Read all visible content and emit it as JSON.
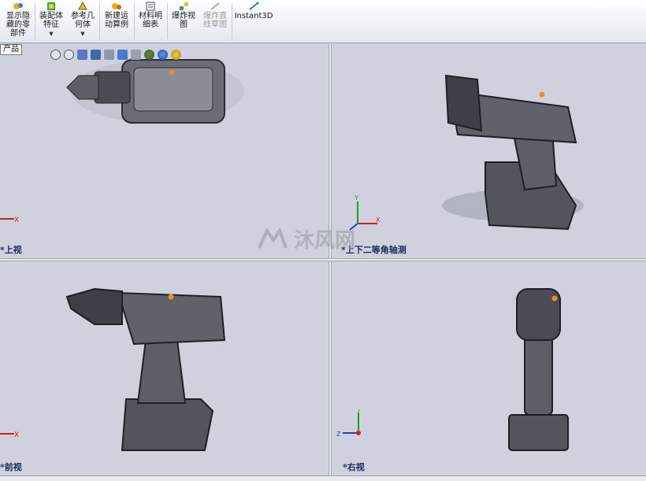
{
  "ribbon": {
    "buttons": [
      {
        "label": "显示隐\n藏的零\n部件",
        "icon": "show-hide-components-icon",
        "dropdown": false
      },
      {
        "label": "装配体\n特征",
        "icon": "assembly-feature-icon",
        "dropdown": true
      },
      {
        "label": "参考几\n何体",
        "icon": "reference-geometry-icon",
        "dropdown": true
      },
      {
        "label": "新建运\n动算例",
        "icon": "new-motion-study-icon",
        "dropdown": false
      },
      {
        "label": "材料明\n细表",
        "icon": "bill-of-materials-icon",
        "dropdown": false
      },
      {
        "label": "爆炸视\n图",
        "icon": "exploded-view-icon",
        "dropdown": false
      },
      {
        "label": "爆炸直\n线草图",
        "icon": "explode-line-sketch-icon",
        "dropdown": false,
        "disabled": true
      },
      {
        "label": "Instant3D",
        "icon": "instant3d-icon",
        "dropdown": false
      }
    ]
  },
  "tree_tab": "产品",
  "views": {
    "top_left": "*上视",
    "top_right": "*上下二等角轴测",
    "bottom_left": "*前视",
    "bottom_right": "*右视"
  },
  "watermark": "沐风网",
  "axes": {
    "x": "X",
    "y": "Y",
    "z": "Z"
  },
  "colors": {
    "viewport_bg": "#cfd2de",
    "model": "#5a5c66",
    "accent": "#f28c1b",
    "axis_red": "#d02020",
    "axis_green": "#209a20",
    "axis_blue": "#2040c8"
  }
}
